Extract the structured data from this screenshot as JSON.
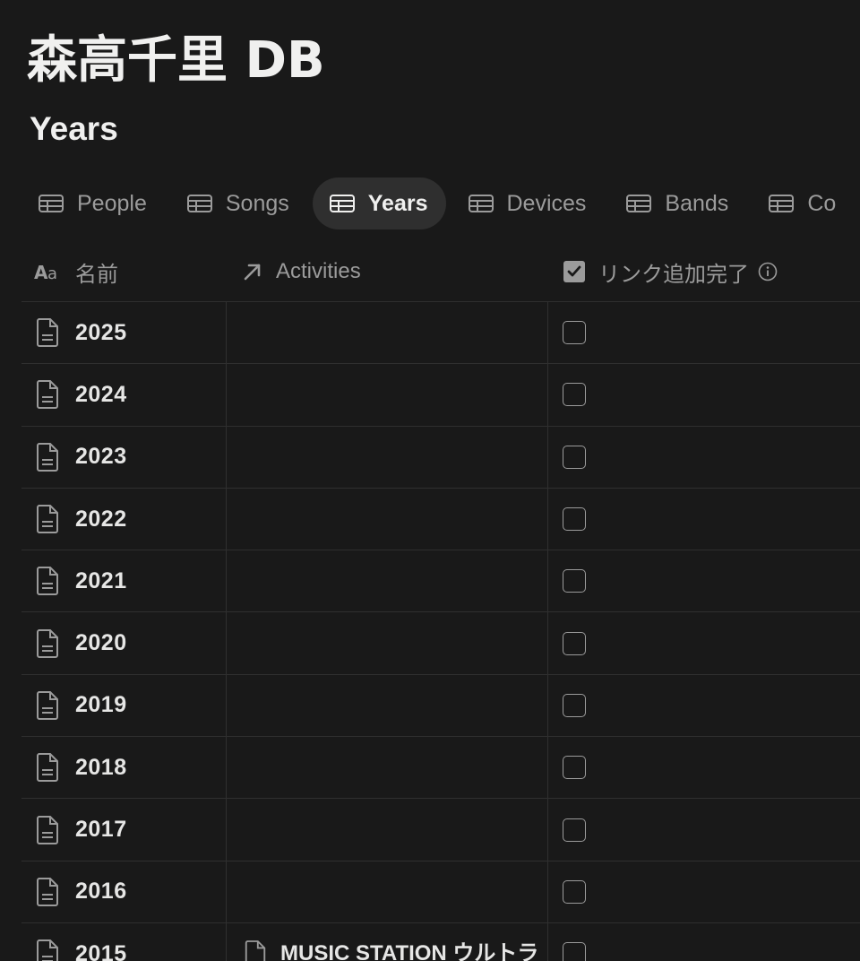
{
  "database": {
    "title": "森高千里 DB"
  },
  "view": {
    "title": "Years"
  },
  "tabs": [
    {
      "label": "People",
      "icon": "table-icon",
      "active": false
    },
    {
      "label": "Songs",
      "icon": "table-icon",
      "active": false
    },
    {
      "label": "Years",
      "icon": "table-icon",
      "active": true
    },
    {
      "label": "Devices",
      "icon": "table-icon",
      "active": false
    },
    {
      "label": "Bands",
      "icon": "table-icon",
      "active": false
    },
    {
      "label": "Co",
      "icon": "table-icon",
      "active": false
    }
  ],
  "table": {
    "columns": [
      {
        "label": "名前",
        "icon": "text-type-icon"
      },
      {
        "label": "Activities",
        "icon": "relation-arrow-icon"
      },
      {
        "label": "リンク追加完了",
        "icon": "checkbox-type-icon",
        "info_icon": "info-icon"
      }
    ],
    "rows": [
      {
        "name": "2025",
        "activity": "",
        "checked": false
      },
      {
        "name": "2024",
        "activity": "",
        "checked": false
      },
      {
        "name": "2023",
        "activity": "",
        "checked": false
      },
      {
        "name": "2022",
        "activity": "",
        "checked": false
      },
      {
        "name": "2021",
        "activity": "",
        "checked": false
      },
      {
        "name": "2020",
        "activity": "",
        "checked": false
      },
      {
        "name": "2019",
        "activity": "",
        "checked": false
      },
      {
        "name": "2018",
        "activity": "",
        "checked": false
      },
      {
        "name": "2017",
        "activity": "",
        "checked": false
      },
      {
        "name": "2016",
        "activity": "",
        "checked": false
      },
      {
        "name": "2015",
        "activity": "MUSIC STATION ウルトラ",
        "checked": false
      }
    ]
  },
  "colors": {
    "background": "#191919",
    "text": "#e6e6e5",
    "muted": "#9b9b9b",
    "active_tab_bg": "#2f2f2f",
    "border": "#2f2f2f"
  }
}
